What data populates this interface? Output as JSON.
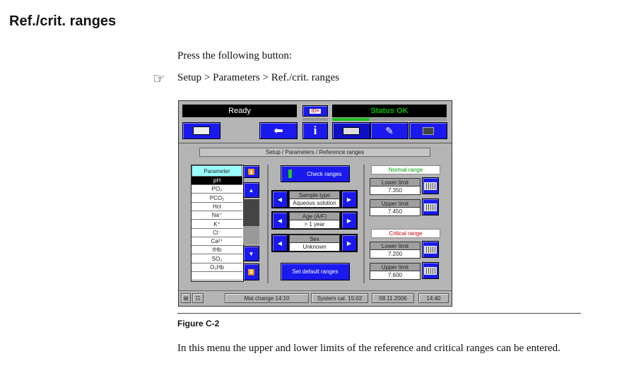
{
  "heading": "Ref./crit. ranges",
  "instruction": "Press the following button:",
  "path": "Setup > Parameters > Ref./crit. ranges",
  "screen": {
    "status_left": "Ready",
    "status_right": "Status OK",
    "status_right_color": "#00c000",
    "breadcrumb": "Setup / Parameters / Reference ranges",
    "param_header": "Parameter",
    "params": [
      "pH",
      "PO₂",
      "PCO₂",
      "Hct",
      "Na⁺",
      "K⁺",
      "Cl⁻",
      "Ca²⁺",
      "tHb",
      "SO₂",
      "O₂Hb",
      ""
    ],
    "selected_param": "pH",
    "check_ranges": "Check ranges",
    "selectors": [
      {
        "label": "Sample type",
        "value": "Aqueous solution"
      },
      {
        "label": "Age (A/F)",
        "value": "> 1 year"
      },
      {
        "label": "Sex",
        "value": "Unknown"
      }
    ],
    "set_default": "Set default ranges",
    "normal_range": {
      "title": "Normal range",
      "color": "#00a000",
      "lower_label": "Lower limit",
      "lower": "7.350",
      "upper_label": "Upper limit",
      "upper": "7.450"
    },
    "critical_range": {
      "title": "Critical range",
      "color": "#c00000",
      "lower_label": "Lower limit",
      "lower": "7.200",
      "upper_label": "Upper limit",
      "upper": "7.600"
    },
    "footer": {
      "mat_change": "Mat change 14:10",
      "system_cal": "System cal. 15:02",
      "date": "08.11.2006",
      "time": "14:40"
    }
  },
  "figure_caption": "Figure C-2",
  "description": "In this menu the upper and lower limits of the reference and critical ranges can be entered."
}
